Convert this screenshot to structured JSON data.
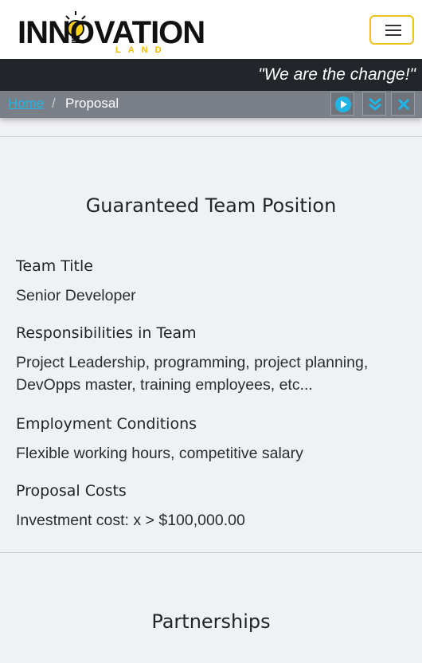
{
  "header": {
    "logo_text": "INNOVATION",
    "logo_subtext": "LAND",
    "menu_icon": "hamburger-icon",
    "accent_color": "#f2c21b"
  },
  "slogan": "\"We are the change!\"",
  "breadcrumb": {
    "home": "Home",
    "separator": "/",
    "current": "Proposal"
  },
  "toolbar": {
    "play_icon": "play-icon",
    "expand_icon": "double-chevron-down-icon",
    "close_icon": "close-icon",
    "icon_color": "#1fb5e6"
  },
  "position_section": {
    "title": "Guaranteed Team Position",
    "fields": [
      {
        "label": "Team Title",
        "value": "Senior Developer"
      },
      {
        "label": "Responsibilities in Team",
        "value": "Project Leadership, programming, project planning, DevOpps master, training employees, etc..."
      },
      {
        "label": "Employment Conditions",
        "value": "Flexible working hours, competitive salary"
      },
      {
        "label": "Proposal Costs",
        "value": "Investment cost: x > $100,000.00"
      }
    ]
  },
  "partnerships_section": {
    "title": "Partnerships"
  }
}
